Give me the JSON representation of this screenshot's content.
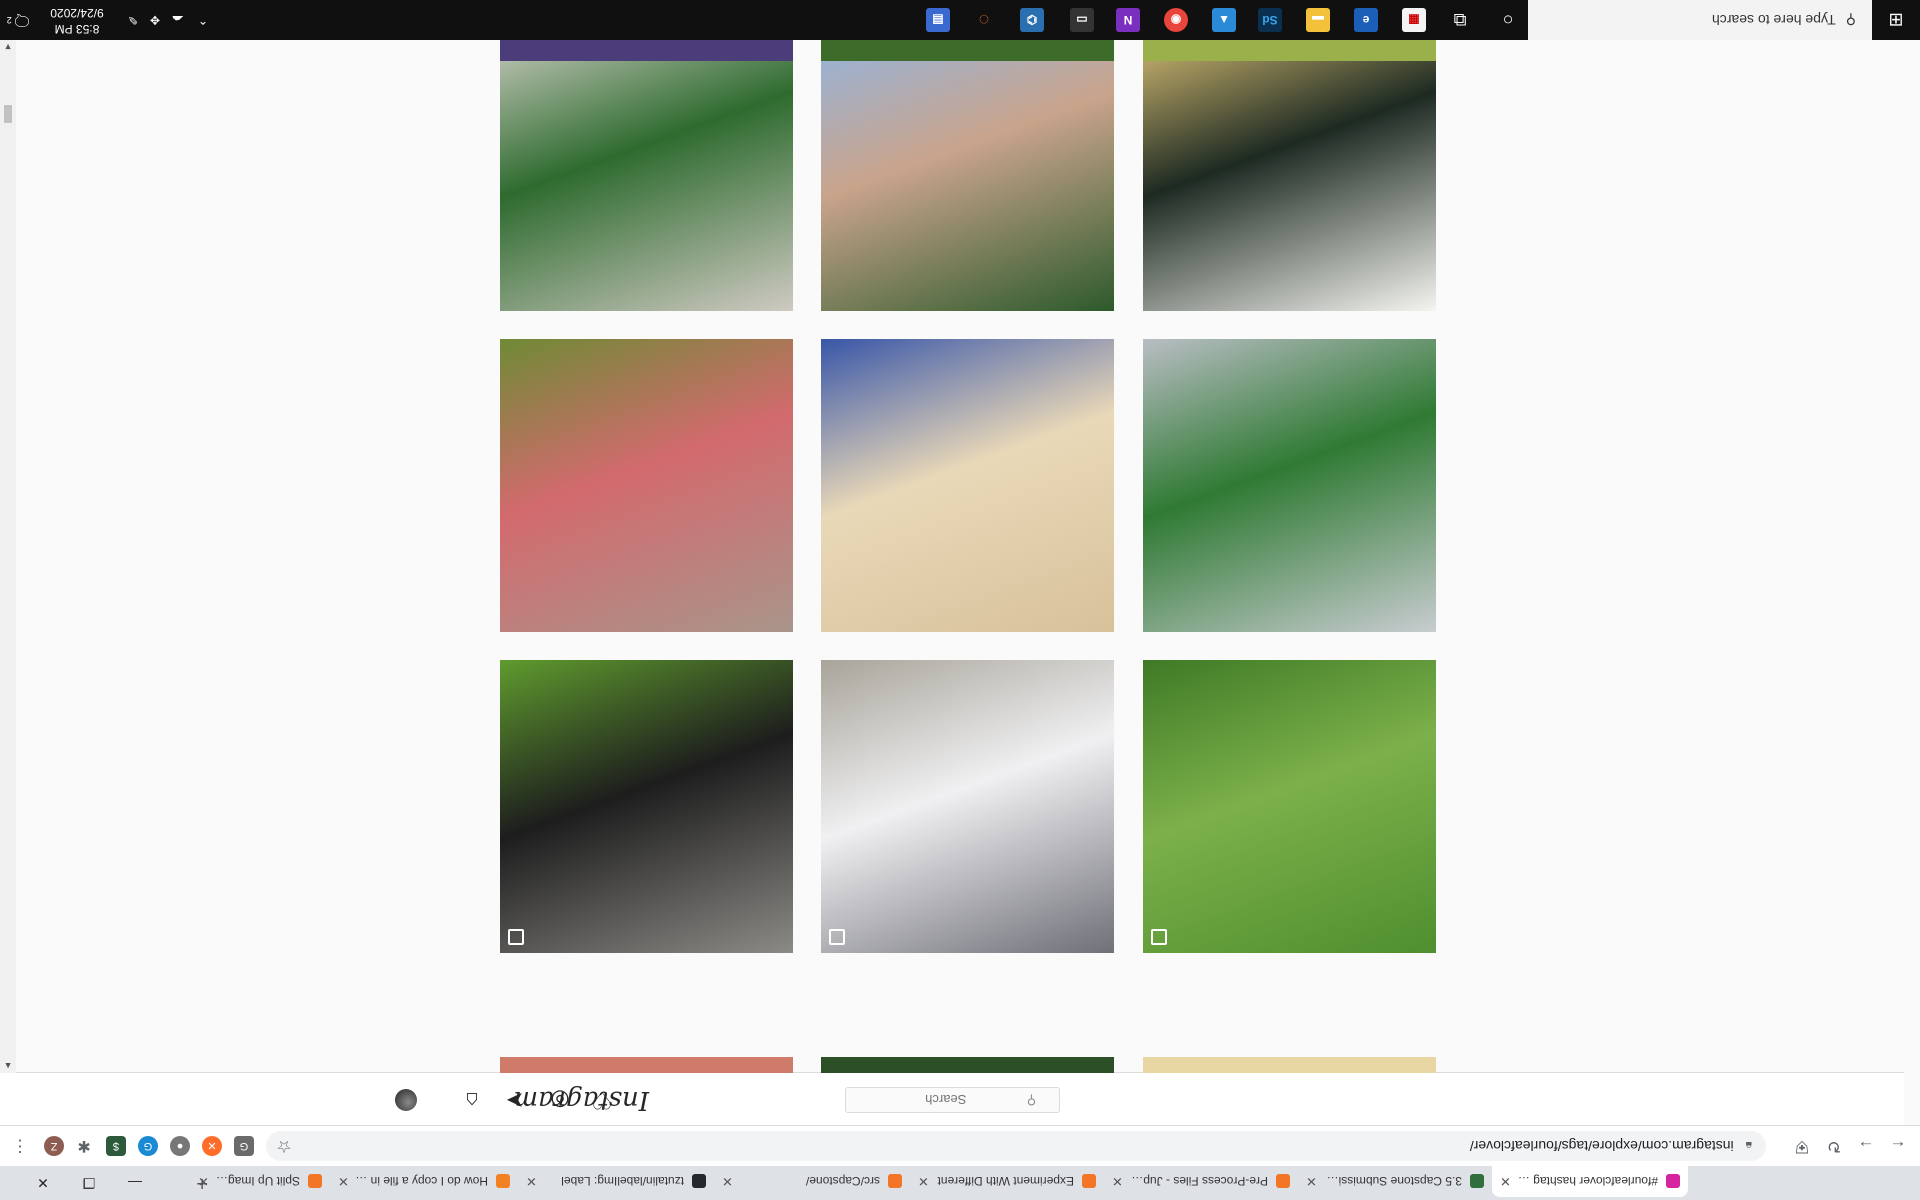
{
  "browser": {
    "tabs": [
      {
        "title": "#fourleafclover hashtag on",
        "favicon": "instagram-icon",
        "color": "#d6249f",
        "active": true
      },
      {
        "title": "3.5 Capstone Submission - ",
        "favicon": "notebook-icon",
        "color": "#2f6f3e",
        "active": false
      },
      {
        "title": "Pre-Process Files - Jupyter",
        "favicon": "jupyter-icon",
        "color": "#f37626",
        "active": false
      },
      {
        "title": "Experiment With Different",
        "favicon": "jupyter-icon",
        "color": "#f37626",
        "active": false
      },
      {
        "title": "src/Capstone/",
        "favicon": "jupyter-icon",
        "color": "#f37626",
        "active": false
      },
      {
        "title": "tzutalin/labelImg: Label",
        "favicon": "github-icon",
        "color": "#24292e",
        "active": false
      },
      {
        "title": "How do I copy a file in Pyth",
        "favicon": "stackoverflow-icon",
        "color": "#f48024",
        "active": false
      },
      {
        "title": "Split Up Images - Jupyter N",
        "favicon": "jupyter-icon",
        "color": "#f37626",
        "active": false
      }
    ],
    "url": "instagram.com/explore/tags/fourleafclover/",
    "profile_initial": "Z"
  },
  "instagram": {
    "logo": "Instagram",
    "search_placeholder": "Search",
    "search_glyph": "⚲",
    "nav_icons": [
      "home-icon",
      "direct-icon",
      "explore-icon",
      "activity-icon",
      "profile-avatar"
    ]
  },
  "posts": [
    {
      "subject": "gold four-leaf clover ornament on black box",
      "colors": [
        "#f5f5f0",
        "#1d2a22",
        "#e6c97a"
      ]
    },
    {
      "subject": "hand holding clover against sky",
      "colors": [
        "#2d5a2b",
        "#c9a48c",
        "#8fb6e6"
      ]
    },
    {
      "subject": "four-leaf clover on concrete",
      "colors": [
        "#cfcac2",
        "#2e6b2f",
        "#d8d4cc"
      ]
    },
    {
      "subject": "clovers on grey fabric",
      "colors": [
        "#c8ccd0",
        "#2f7a33",
        "#b9bec4"
      ]
    },
    {
      "subject": "four-leaf clover tattoo",
      "colors": [
        "#d7c19a",
        "#e9d8b8",
        "#3856a8"
      ]
    },
    {
      "subject": "fingers holding four-leaf clover",
      "colors": [
        "#a9958a",
        "#d36a6e",
        "#6f8a35"
      ]
    },
    {
      "subject": "clover in grass",
      "colors": [
        "#4f8f2f",
        "#7cb04a",
        "#3e7a26"
      ]
    },
    {
      "subject": "white car",
      "colors": [
        "#6f7078",
        "#f0f0f2",
        "#a8a49a"
      ]
    },
    {
      "subject": "dog on grass",
      "colors": [
        "#8c8a86",
        "#1d1d1d",
        "#5f9b2e"
      ]
    }
  ],
  "taskbar": {
    "search_placeholder": "Type here to search",
    "time": "8:53 PM",
    "date": "9/24/2020",
    "notification_count": "2"
  }
}
